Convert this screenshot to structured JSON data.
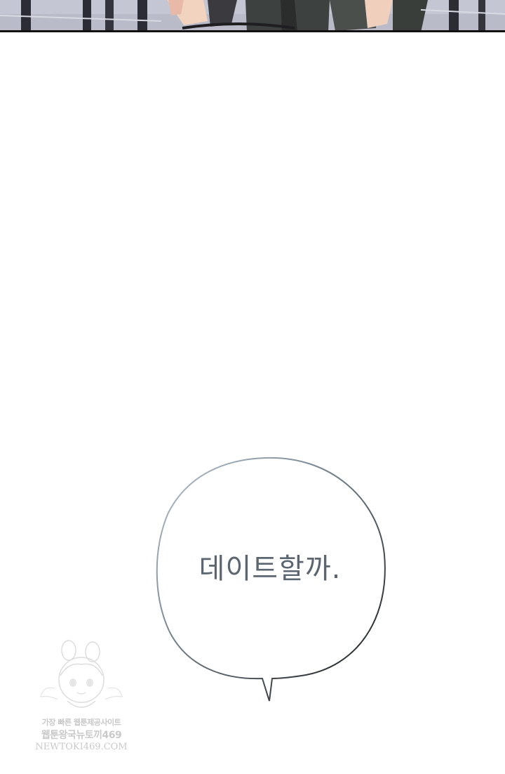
{
  "speech_bubble": {
    "text": "데이트할까."
  },
  "watermark": {
    "line1": "가장 빠른 웹툰제공사이트",
    "line2": "웹툰왕국뉴토끼469",
    "line3": "NEWTOKI469.COM"
  }
}
